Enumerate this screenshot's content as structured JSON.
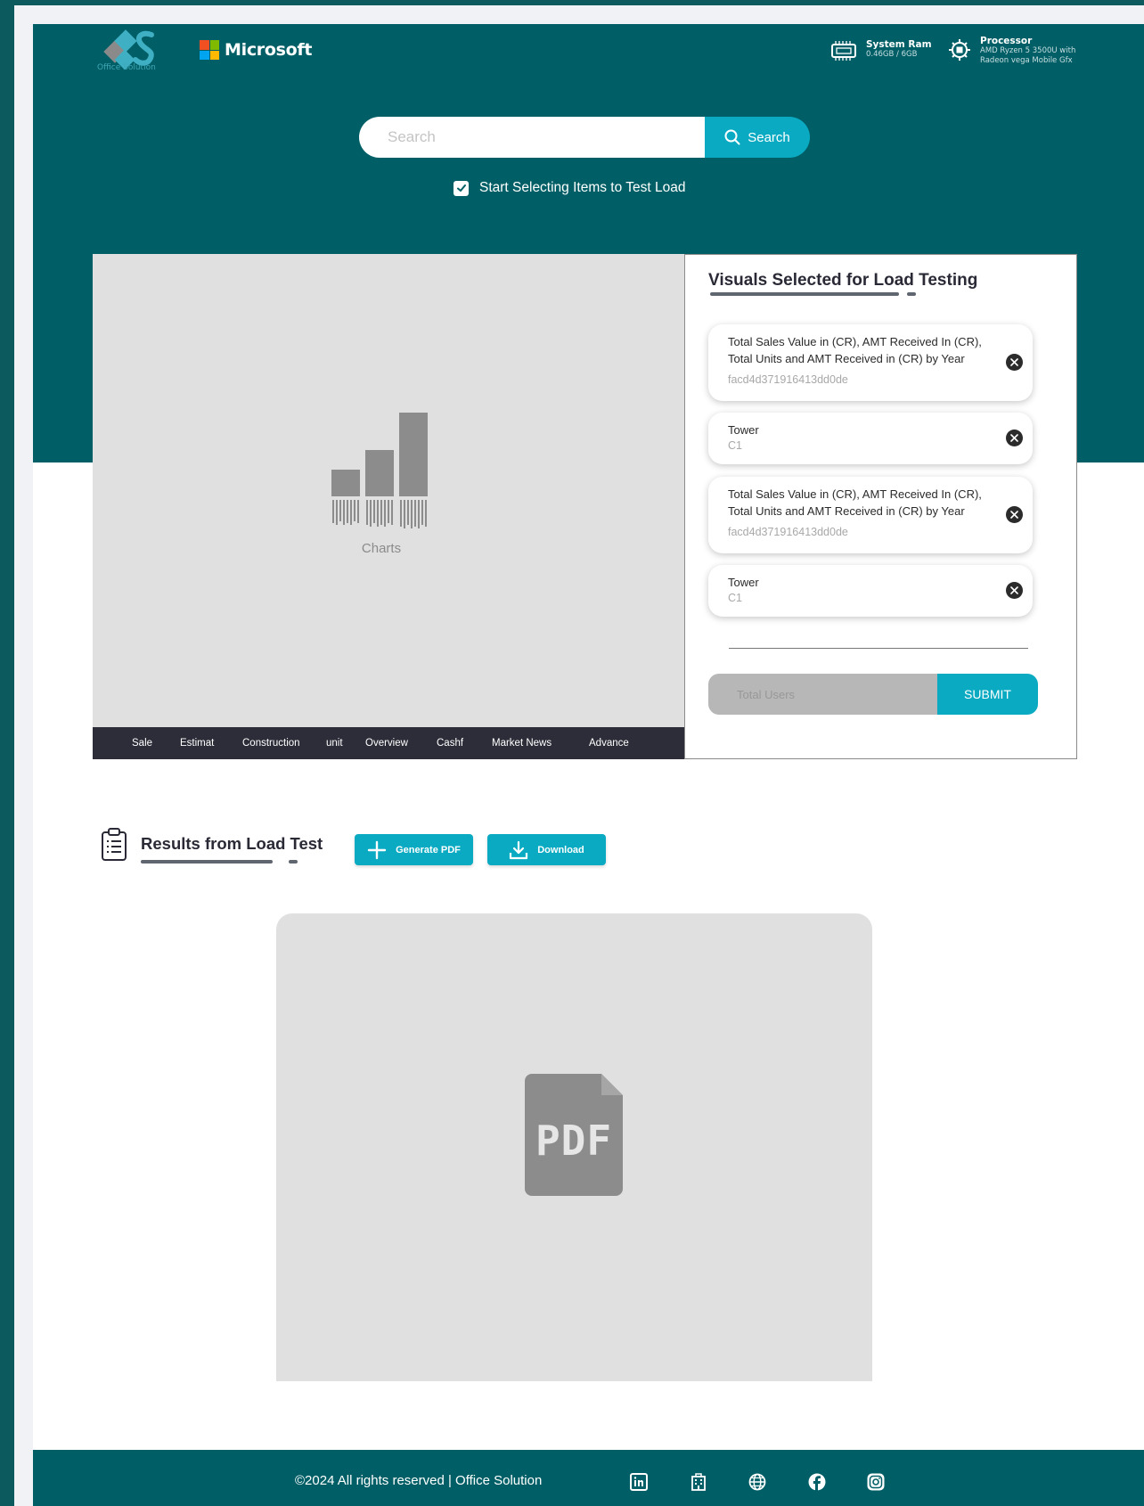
{
  "header": {
    "logo_text": "Office Solution",
    "brand_name": "Microsoft",
    "system_ram": {
      "title": "System Ram",
      "value": "0.46GB / 6GB"
    },
    "processor": {
      "title": "Processor",
      "line1": "AMD Ryzen 5 3500U with",
      "line2": "Radeon vega Mobile Gfx"
    }
  },
  "search": {
    "placeholder": "Search",
    "button_label": "Search"
  },
  "select_toggle": {
    "label": "Start Selecting Items to Test Load",
    "checked": true
  },
  "visual_area": {
    "placeholder_label": "Charts",
    "tabs": [
      "Sale",
      "Estimat",
      "Construction",
      "unit",
      "Overview",
      "Cashf",
      "Market News",
      "Advance"
    ]
  },
  "panel": {
    "title": "Visuals Selected for Load Testing",
    "items": [
      {
        "title": "Total Sales Value in (CR), AMT Received In (CR), Total Units and AMT Received in (CR) by Year",
        "id": "facd4d371916413dd0de"
      },
      {
        "title": "Tower",
        "id": "C1"
      },
      {
        "title": "Total Sales Value in (CR), AMT Received In (CR), Total Units and AMT Received in (CR) by Year",
        "id": "facd4d371916413dd0de"
      },
      {
        "title": "Tower",
        "id": "C1"
      }
    ],
    "users_placeholder": "Total Users",
    "submit_label": "SUBMIT"
  },
  "results": {
    "title": "Results from Load Test",
    "generate_label": "Generate PDF",
    "download_label": "Download",
    "pdf_label": "PDF"
  },
  "footer": {
    "text": "©2024 All rights reserved | Office Solution"
  },
  "icons": {
    "ram": "memory-chip-icon",
    "processor": "cpu-icon",
    "search": "search-icon",
    "close": "close-circle-icon",
    "clipboard": "clipboard-list-icon",
    "plus": "plus-icon",
    "download": "download-icon",
    "social": [
      "linkedin-icon",
      "building-icon",
      "globe-icon",
      "facebook-icon",
      "instagram-icon"
    ]
  },
  "colors": {
    "brand_teal": "#005f66",
    "accent_cyan": "#0aabc2",
    "dark_text": "#2a2a36",
    "tab_bar": "#2d2d3a",
    "placeholder_gray": "#e0e0e0"
  }
}
